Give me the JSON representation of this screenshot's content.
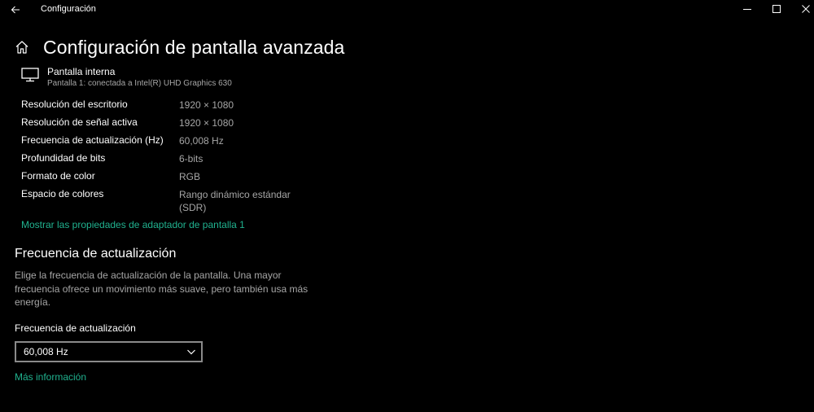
{
  "window": {
    "title": "Configuración"
  },
  "header": {
    "title": "Configuración de pantalla avanzada"
  },
  "display": {
    "name": "Pantalla interna",
    "subtitle": "Pantalla 1: conectada a Intel(R) UHD Graphics 630"
  },
  "info": [
    {
      "label": "Resolución del escritorio",
      "value": "1920 × 1080"
    },
    {
      "label": "Resolución de señal activa",
      "value": "1920 × 1080"
    },
    {
      "label": "Frecuencia de actualización (Hz)",
      "value": "60,008 Hz"
    },
    {
      "label": "Profundidad de bits",
      "value": "6-bits"
    },
    {
      "label": "Formato de color",
      "value": "RGB"
    },
    {
      "label": "Espacio de colores",
      "value": "Rango dinámico estándar",
      "value_line2": "(SDR)"
    }
  ],
  "adapter_link": "Mostrar las propiedades de adaptador de pantalla 1",
  "refresh_section": {
    "title": "Frecuencia de actualización",
    "description": "Elige la frecuencia de actualización de la pantalla. Una mayor frecuencia ofrece un movimiento más suave, pero también usa más energía.",
    "dropdown_label": "Frecuencia de actualización",
    "dropdown_value": "60,008 Hz",
    "more_info": "Más información"
  },
  "colors": {
    "background": "#000000",
    "link": "#20b28f",
    "secondary_text": "#a6a6a6"
  },
  "icons": [
    "back-arrow-icon",
    "minimize-icon",
    "maximize-icon",
    "close-icon",
    "home-icon",
    "monitor-icon",
    "chevron-down-icon"
  ]
}
